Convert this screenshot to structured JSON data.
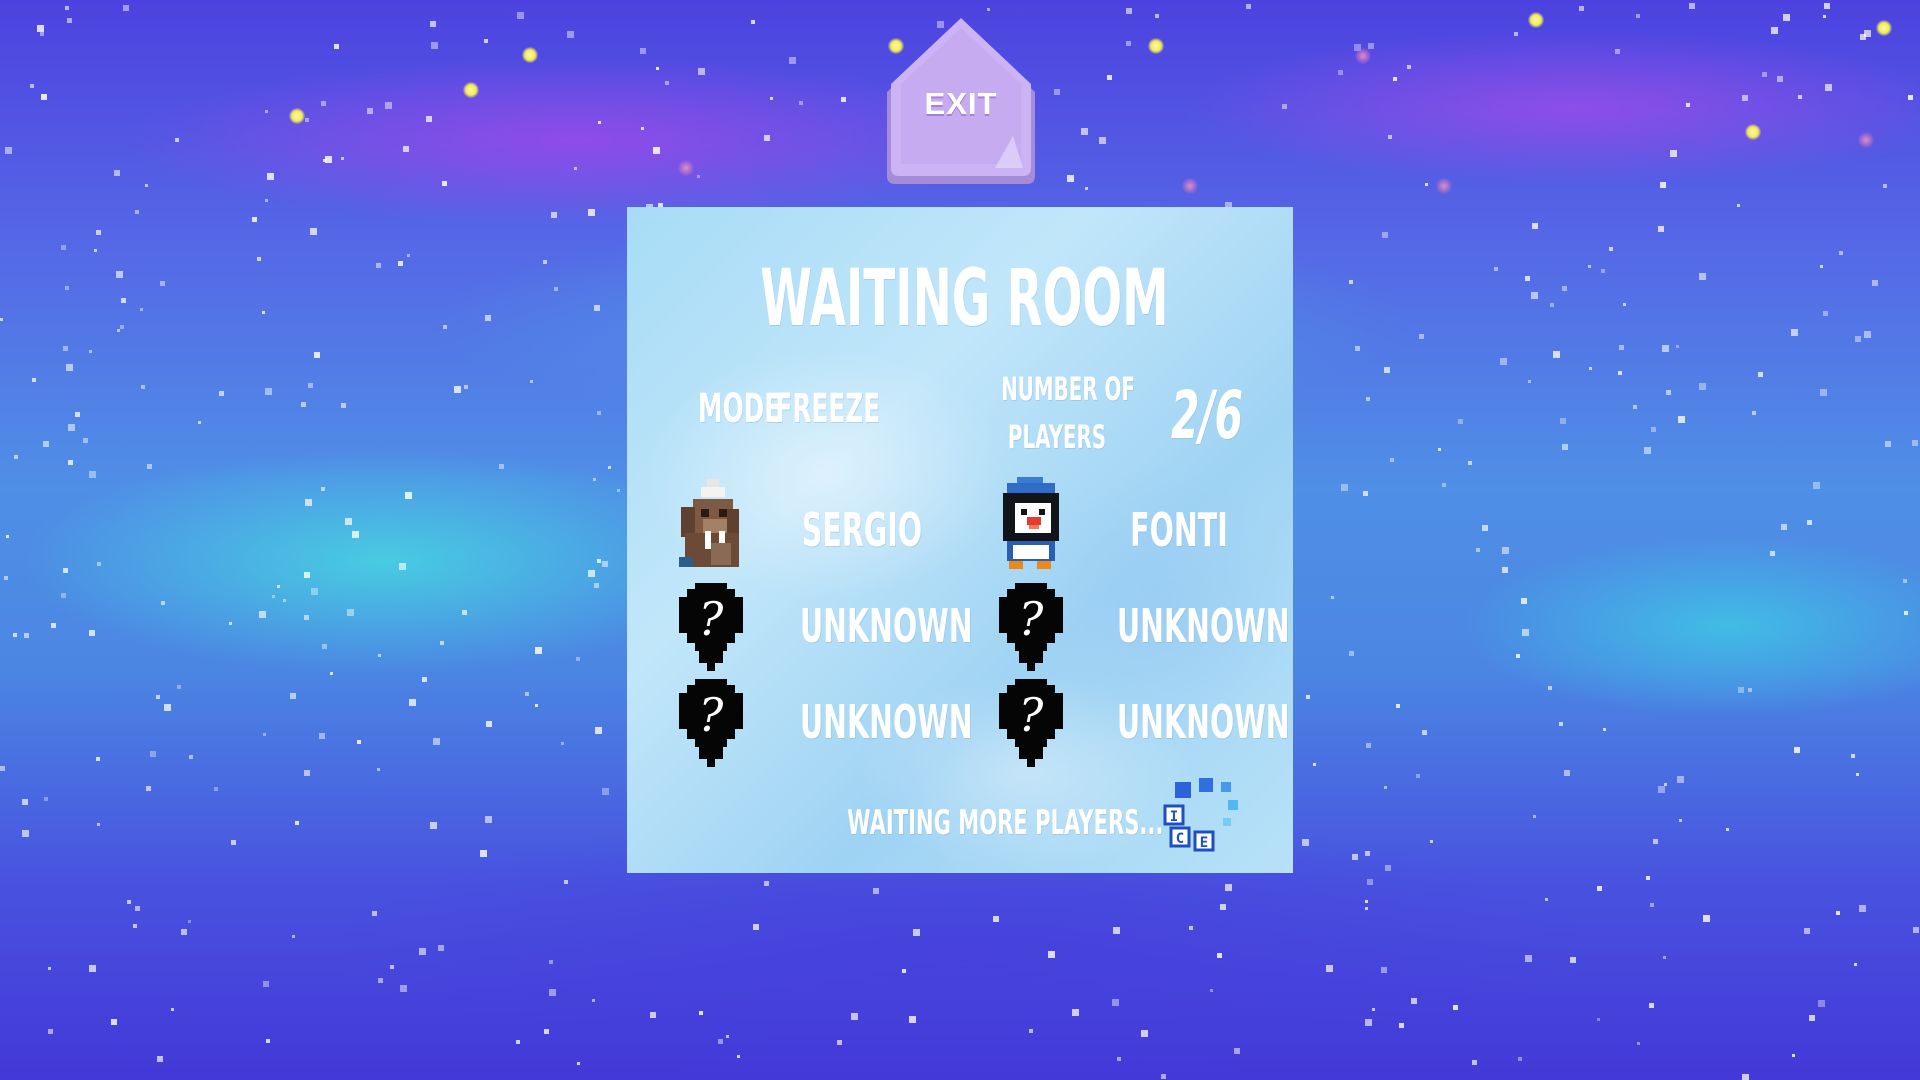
{
  "exit_button": {
    "label": "EXIT"
  },
  "waiting_room": {
    "title": "WAITING ROOM",
    "mode_label": "MODE",
    "mode_value": "FREEZE",
    "players_label_line1": "NUMBER OF",
    "players_label_line2": "PLAYERS",
    "players_count": "2/6",
    "players": [
      {
        "name": "SERGIO",
        "avatar": "walrus-icon"
      },
      {
        "name": "FONTI",
        "avatar": "penguin-icon"
      },
      {
        "name": "UNKNOWN",
        "avatar": "unknown-player-icon"
      },
      {
        "name": "UNKNOWN",
        "avatar": "unknown-player-icon"
      },
      {
        "name": "UNKNOWN",
        "avatar": "unknown-player-icon"
      },
      {
        "name": "UNKNOWN",
        "avatar": "unknown-player-icon"
      }
    ],
    "status_text": "WAITING MORE PLAYERS...",
    "loader": {
      "letters": [
        "I",
        "C",
        "E"
      ],
      "icon": "ice-loading-spinner-icon"
    }
  },
  "colors": {
    "panel": "#b3e0f7",
    "exit_button": "#c9aef2",
    "text": "#ffffff",
    "loader_blue": "#2f6fe0"
  }
}
